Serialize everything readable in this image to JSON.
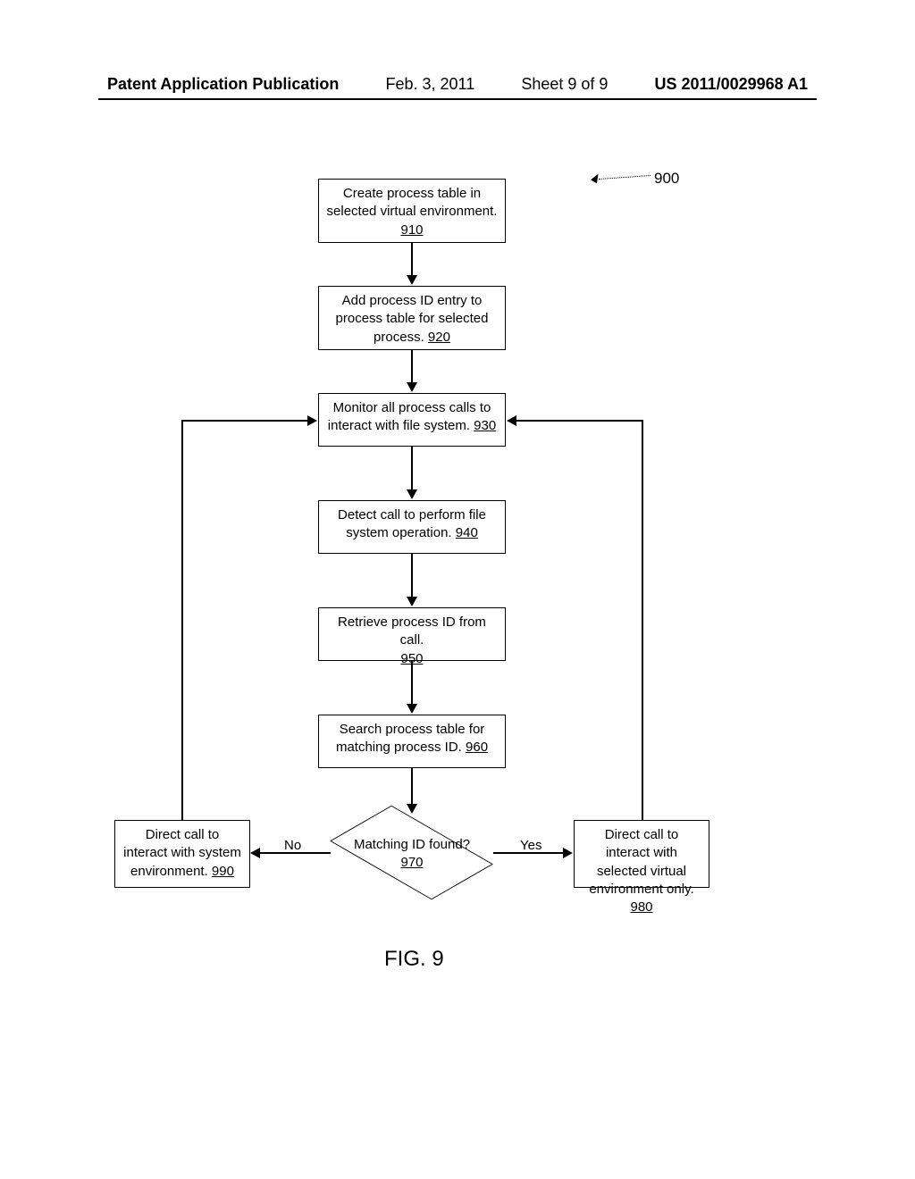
{
  "header": {
    "pub": "Patent Application Publication",
    "date": "Feb. 3, 2011",
    "sheet": "Sheet 9 of 9",
    "pubno": "US 2011/0029968 A1"
  },
  "ref900": "900",
  "steps": {
    "b910": {
      "text": "Create process table in selected virtual environment.",
      "ref": "910"
    },
    "b920": {
      "text": "Add process ID entry to process table for selected process.",
      "ref": "920"
    },
    "b930": {
      "text": "Monitor all process calls to interact with file system.",
      "ref": "930"
    },
    "b940": {
      "text": "Detect call to perform file system operation.",
      "ref": "940"
    },
    "b950": {
      "text": "Retrieve process ID from call.",
      "ref": "950"
    },
    "b960": {
      "text": "Search process table for matching process ID.",
      "ref": "960"
    },
    "d970": {
      "text": "Matching ID found?",
      "ref": "970"
    },
    "b980": {
      "text": "Direct call to interact with selected virtual environment only.",
      "ref": "980"
    },
    "b990": {
      "text": "Direct call to interact with system environment.",
      "ref": "990"
    }
  },
  "labels": {
    "yes": "Yes",
    "no": "No"
  },
  "caption": "FIG. 9"
}
